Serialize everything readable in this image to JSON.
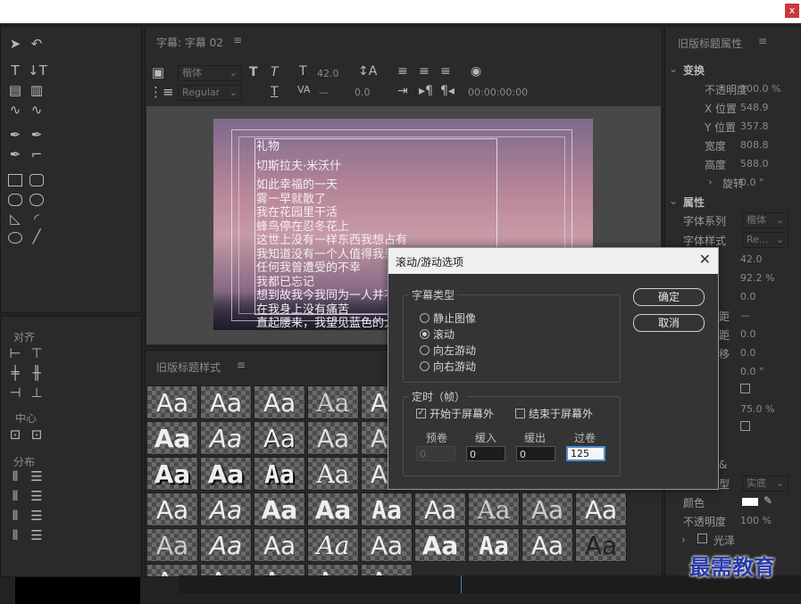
{
  "window": {
    "close_glyph": "x"
  },
  "title_panel": {
    "tab_label": "字幕: 字幕 02",
    "menu_glyph": "≡"
  },
  "toolbar": {
    "font_family": "楷体",
    "font_style": "Regular",
    "font_size": "42.0",
    "tracking": "—",
    "leading": "0.0",
    "timecode": "00:00:00:00"
  },
  "canvas_text": [
    "礼物",
    "切斯拉夫·米沃什",
    "如此幸福的一天",
    "雾一早就散了",
    "我在花园里干活",
    "蜂鸟停在忍冬花上",
    "这世上没有一样东西我想占有",
    "我知道没有一个人值得我羡慕",
    "任何我曾遭受的不幸",
    "我都已忘记",
    "想到故我今我同为一人并不使我难为情",
    "在我身上没有痛苦",
    "直起腰来，我望见蓝色的大海和帆影"
  ],
  "align_section": {
    "label_align": "对齐",
    "label_center": "中心",
    "label_distribute": "分布"
  },
  "styles_panel": {
    "title": "旧版标题样式",
    "menu_glyph": "≡",
    "sample_text": "Aa"
  },
  "props_panel": {
    "title": "旧版标题属性",
    "menu_glyph": "≡",
    "section_transform": "变换",
    "opacity_label": "不透明度",
    "opacity_value": "100.0 %",
    "x_label": "X 位置",
    "x_value": "548.9",
    "y_label": "Y 位置",
    "y_value": "357.8",
    "width_label": "宽度",
    "width_value": "808.8",
    "height_label": "高度",
    "height_value": "588.0",
    "rotation_label": "旋转",
    "rotation_value": "0.0 °",
    "section_props": "属性",
    "font_family_label": "字体系列",
    "font_family_value": "楷体",
    "font_style_label": "字体样式",
    "font_style_value": "Re...",
    "p_42": "42.0",
    "p_922": "92.2 %",
    "p_00a": "0.0",
    "p_dash": "—",
    "p_00b": "0.0",
    "p_00c": "0.0",
    "p_00d": "0.0 °",
    "p_75": "75.0 %",
    "label_ju": "距",
    "label_ju2": "距",
    "label_yi": "移",
    "label_and": "&",
    "label_xing": "型",
    "fill_type_value": "实底",
    "color_label": "颜色",
    "opacity2_label": "不透明度",
    "opacity2_value": "100 %",
    "sheen_label": "光泽"
  },
  "dialog": {
    "title": "滚动/游动选项",
    "close_glyph": "✕",
    "group_type_label": "字幕类型",
    "options": [
      "静止图像",
      "滚动",
      "向左游动",
      "向右游动"
    ],
    "selected_option": "滚动",
    "ok_label": "确定",
    "cancel_label": "取消",
    "group_timing_label": "定时（帧）",
    "start_offscreen_label": "开始于屏幕外",
    "end_offscreen_label": "结束于屏幕外",
    "start_offscreen_checked": true,
    "end_offscreen_checked": false,
    "preroll_label": "预卷",
    "easein_label": "缓入",
    "easeout_label": "缓出",
    "postroll_label": "过卷",
    "preroll_value": "0",
    "easein_value": "0",
    "easeout_value": "0",
    "postroll_value": "125"
  },
  "watermark": "最需教育"
}
